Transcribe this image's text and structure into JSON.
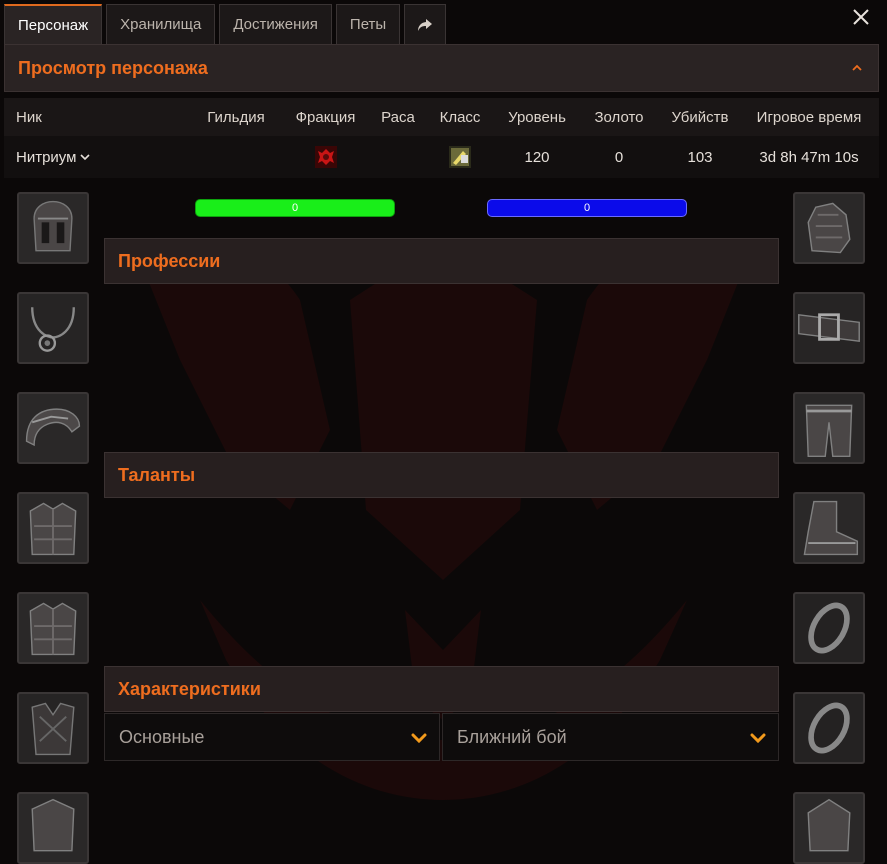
{
  "tabs": [
    {
      "label": "Персонаж",
      "active": true
    },
    {
      "label": "Хранилища",
      "active": false
    },
    {
      "label": "Достижения",
      "active": false
    },
    {
      "label": "Петы",
      "active": false
    }
  ],
  "share_icon": "share-arrow-icon",
  "close_icon": "close-icon",
  "header": {
    "title": "Просмотр персонажа",
    "collapse_icon": "chevron-up-icon"
  },
  "table": {
    "columns": [
      "Ник",
      "Гильдия",
      "Фракция",
      "Раса",
      "Класс",
      "Уровень",
      "Золото",
      "Убийств",
      "Игровое время"
    ],
    "row": {
      "nick": "Нитриум",
      "guild": "",
      "faction_icon": "horde-faction-icon",
      "race": "",
      "class_icon": "class-icon",
      "level": "120",
      "gold": "0",
      "kills": "103",
      "playtime": "3d 8h 47m 10s"
    }
  },
  "bars": {
    "health": "0",
    "mana": "0"
  },
  "sections": {
    "professions": "Профессии",
    "talents": "Таланты",
    "stats": "Характеристики"
  },
  "selects": {
    "basic": "Основные",
    "melee": "Ближний бой"
  },
  "colors": {
    "accent": "#ee6d1f",
    "health": "#19ee19",
    "mana": "#0b0bea"
  },
  "equipment": {
    "left": [
      "head-slot-icon",
      "neck-slot-icon",
      "shoulder-slot-icon",
      "chest-slot-icon",
      "shirt-slot-icon",
      "tabard-slot-icon",
      "wrist-slot-icon"
    ],
    "right": [
      "hands-slot-icon",
      "waist-slot-icon",
      "legs-slot-icon",
      "feet-slot-icon",
      "ring-slot-icon",
      "ring-slot-icon",
      "trinket-slot-icon"
    ]
  }
}
